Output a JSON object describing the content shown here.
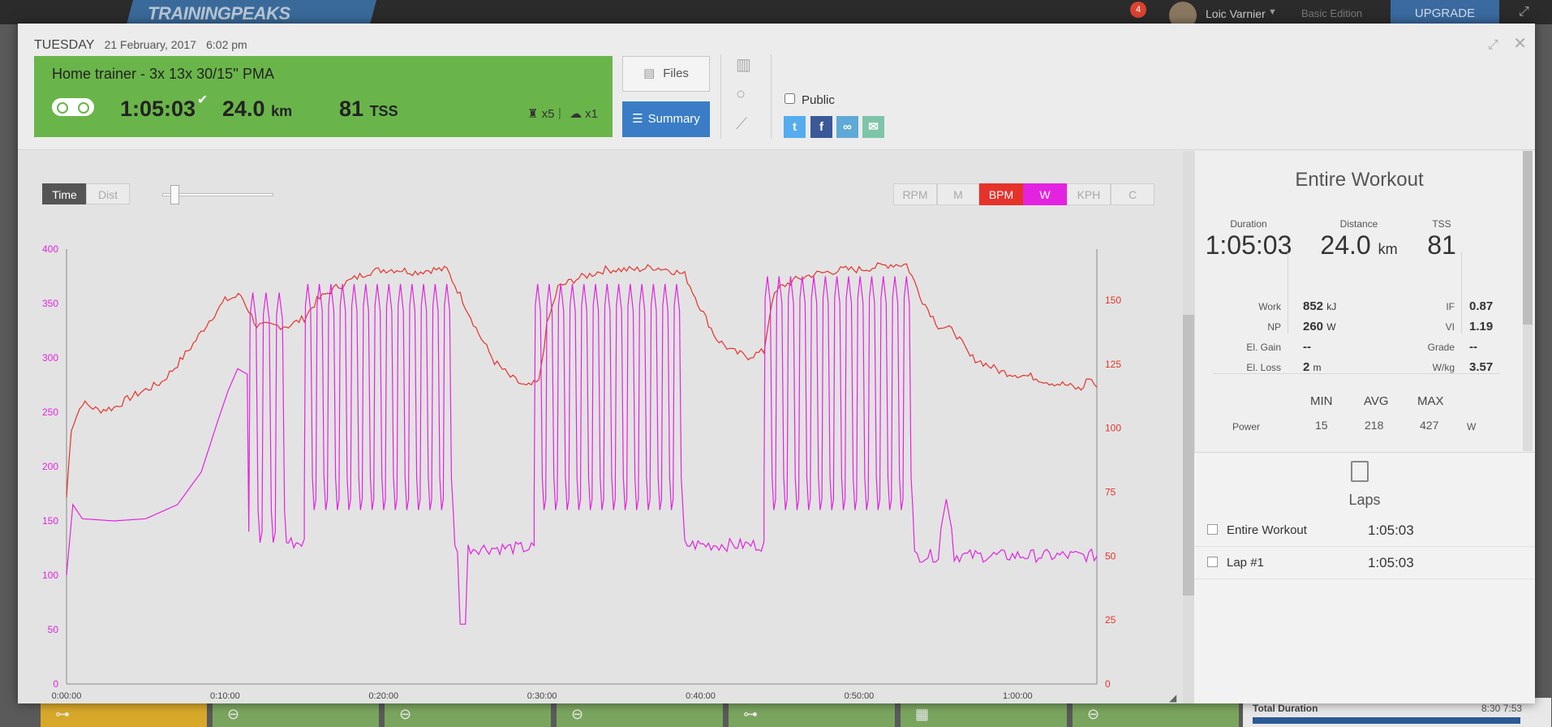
{
  "appbar": {
    "logo": "TRAININGPEAKS",
    "notifications": "4",
    "user": "Loic Varnier",
    "edition": "Basic Edition",
    "upgrade": "UPGRADE"
  },
  "header": {
    "day": "TUESDAY",
    "date": "21 February, 2017",
    "time": "6:02 pm"
  },
  "workout": {
    "title": "Home trainer - 3x 13x 30/15'' PMA",
    "duration": "1:05:03",
    "distance": "24.0",
    "distance_unit": "km",
    "tss": "81",
    "tss_unit": "TSS",
    "likes": "x5",
    "comments": "x1"
  },
  "buttons": {
    "files": "Files",
    "summary": "Summary",
    "public": "Public"
  },
  "chart_controls": {
    "time": "Time",
    "dist": "Dist",
    "channels": [
      "RPM",
      "M",
      "BPM",
      "W",
      "KPH",
      "C"
    ]
  },
  "chart_data": {
    "type": "line",
    "x_tick_labels": [
      "0:00:00",
      "0:10:00",
      "0:20:00",
      "0:30:00",
      "0:40:00",
      "0:50:00",
      "1:00:00"
    ],
    "x_range_min": [
      0,
      65
    ],
    "y_left_ticks": [
      0,
      50,
      100,
      150,
      200,
      250,
      300,
      350,
      400
    ],
    "y_left_range": [
      0,
      400
    ],
    "y_right_ticks": [
      0,
      25,
      50,
      75,
      100,
      125,
      150
    ],
    "y_right_range": [
      0,
      170
    ],
    "colors": {
      "power": "#e323e0",
      "heart_rate": "#e5332b"
    },
    "series": [
      {
        "name": "W",
        "axis": "left",
        "intervals": [
          {
            "start": 11.5,
            "end": 14.0,
            "count": 3,
            "high": 360,
            "low": 130
          },
          {
            "start": 15.0,
            "end": 24.5,
            "count": 13,
            "high": 368,
            "low": 160
          },
          {
            "start": 29.5,
            "end": 39.0,
            "count": 13,
            "high": 368,
            "low": 160
          },
          {
            "start": 44.0,
            "end": 53.5,
            "count": 13,
            "high": 375,
            "low": 160
          }
        ],
        "warmup": [
          [
            0,
            100
          ],
          [
            0.4,
            165
          ],
          [
            1,
            152
          ],
          [
            3,
            150
          ],
          [
            5,
            152
          ],
          [
            7,
            165
          ],
          [
            8.5,
            195
          ],
          [
            9.5,
            240
          ],
          [
            10.2,
            270
          ],
          [
            10.8,
            290
          ],
          [
            11.4,
            285
          ]
        ],
        "recoveries": [
          {
            "start": 14.0,
            "end": 15.0,
            "level": 130
          },
          {
            "start": 24.5,
            "end": 29.5,
            "level": 125,
            "dip_at": 25.0,
            "dip": 55
          },
          {
            "start": 39.0,
            "end": 44.0,
            "level": 128
          },
          {
            "start": 53.5,
            "end": 65.0,
            "level": 118,
            "bump_at": 55.5,
            "bump": 170
          }
        ]
      },
      {
        "name": "BPM",
        "axis": "right",
        "points": [
          [
            0,
            73
          ],
          [
            0.3,
            100
          ],
          [
            1,
            110
          ],
          [
            2,
            107
          ],
          [
            3,
            108
          ],
          [
            4,
            112
          ],
          [
            5,
            115
          ],
          [
            6,
            118
          ],
          [
            7,
            125
          ],
          [
            8,
            133
          ],
          [
            9,
            142
          ],
          [
            10,
            150
          ],
          [
            11,
            152
          ],
          [
            12,
            140
          ],
          [
            13,
            140
          ],
          [
            14,
            140
          ],
          [
            15,
            143
          ],
          [
            15.8,
            150
          ],
          [
            17,
            155
          ],
          [
            18,
            158
          ],
          [
            19,
            161
          ],
          [
            20,
            162
          ],
          [
            21,
            162
          ],
          [
            22,
            161
          ],
          [
            23,
            162
          ],
          [
            24,
            162
          ],
          [
            25,
            150
          ],
          [
            26,
            137
          ],
          [
            27,
            126
          ],
          [
            28,
            120
          ],
          [
            29,
            116
          ],
          [
            29.8,
            118
          ],
          [
            30.3,
            140
          ],
          [
            31,
            155
          ],
          [
            32,
            158
          ],
          [
            33,
            160
          ],
          [
            34,
            162
          ],
          [
            35,
            162
          ],
          [
            36,
            162
          ],
          [
            37,
            163
          ],
          [
            38,
            162
          ],
          [
            39,
            160
          ],
          [
            40,
            147
          ],
          [
            41,
            135
          ],
          [
            42,
            130
          ],
          [
            43,
            128
          ],
          [
            44,
            130
          ],
          [
            44.5,
            150
          ],
          [
            45,
            155
          ],
          [
            46,
            158
          ],
          [
            47,
            160
          ],
          [
            48,
            161
          ],
          [
            49,
            162
          ],
          [
            50,
            162
          ],
          [
            51,
            163
          ],
          [
            52,
            164
          ],
          [
            53,
            164
          ],
          [
            54,
            150
          ],
          [
            55,
            140
          ],
          [
            56,
            138
          ],
          [
            57,
            128
          ],
          [
            58,
            125
          ],
          [
            59,
            122
          ],
          [
            60,
            121
          ],
          [
            61,
            120
          ],
          [
            62,
            118
          ],
          [
            63,
            117
          ],
          [
            64,
            115
          ],
          [
            64.5,
            120
          ],
          [
            65,
            116
          ]
        ]
      }
    ]
  },
  "summary_panel": {
    "title": "Entire Workout",
    "duration_label": "Duration",
    "duration": "1:05:03",
    "distance_label": "Distance",
    "distance": "24.0",
    "distance_unit": "km",
    "tss_label": "TSS",
    "tss": "81",
    "left_stats": [
      {
        "label": "Work",
        "value": "852",
        "unit": "kJ"
      },
      {
        "label": "NP",
        "value": "260",
        "unit": "W"
      },
      {
        "label": "El. Gain",
        "value": "--",
        "unit": ""
      },
      {
        "label": "El. Loss",
        "value": "2",
        "unit": "m"
      }
    ],
    "right_stats": [
      {
        "label": "IF",
        "value": "0.87"
      },
      {
        "label": "VI",
        "value": "1.19"
      },
      {
        "label": "Grade",
        "value": "--"
      },
      {
        "label": "W/kg",
        "value": "3.57"
      }
    ],
    "minmax_headers": [
      "MIN",
      "AVG",
      "MAX"
    ],
    "power": {
      "label": "Power",
      "min": "15",
      "avg": "218",
      "max": "427",
      "unit": "W"
    }
  },
  "laps": {
    "title": "Laps",
    "rows": [
      {
        "name": "Entire Workout",
        "time": "1:05:03"
      },
      {
        "name": "Lap #1",
        "time": "1:05:03"
      }
    ]
  },
  "bottom": {
    "total_label": "Total Duration",
    "total_value": "8:30 7:53"
  }
}
